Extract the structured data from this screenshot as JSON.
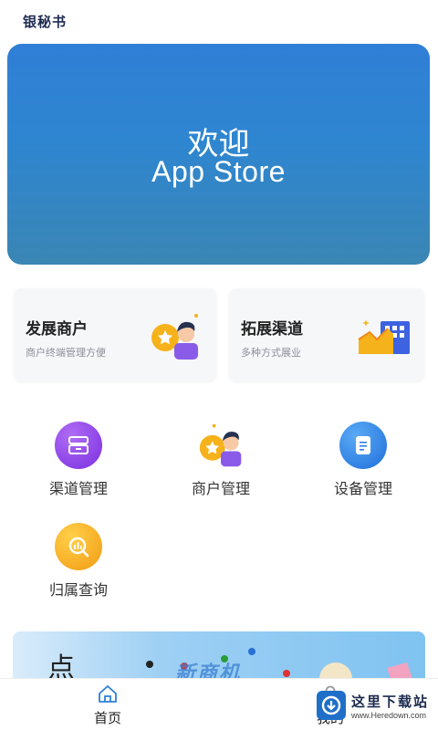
{
  "header": {
    "title": "银秘书"
  },
  "hero": {
    "line1": "欢迎",
    "line2": "App Store"
  },
  "cards": [
    {
      "title": "发展商户",
      "subtitle": "商户终端管理方便",
      "icon": "merchant-icon"
    },
    {
      "title": "拓展渠道",
      "subtitle": "多种方式展业",
      "icon": "building-chart-icon"
    }
  ],
  "grid": [
    {
      "label": "渠道管理",
      "icon": "drawer-icon",
      "color": "#8b3fe6"
    },
    {
      "label": "商户管理",
      "icon": "merchant-icon",
      "color": "#f5b324"
    },
    {
      "label": "设备管理",
      "icon": "document-icon",
      "color": "#2f86e8"
    },
    {
      "label": "归属查询",
      "icon": "search-chart-icon",
      "color": "#f5a623"
    }
  ],
  "banner": {
    "text": "新商机"
  },
  "tabbar": {
    "home": "首页",
    "mine": "我的"
  },
  "watermark": {
    "cn": "这里下载站",
    "en": "www.Heredown.com"
  }
}
